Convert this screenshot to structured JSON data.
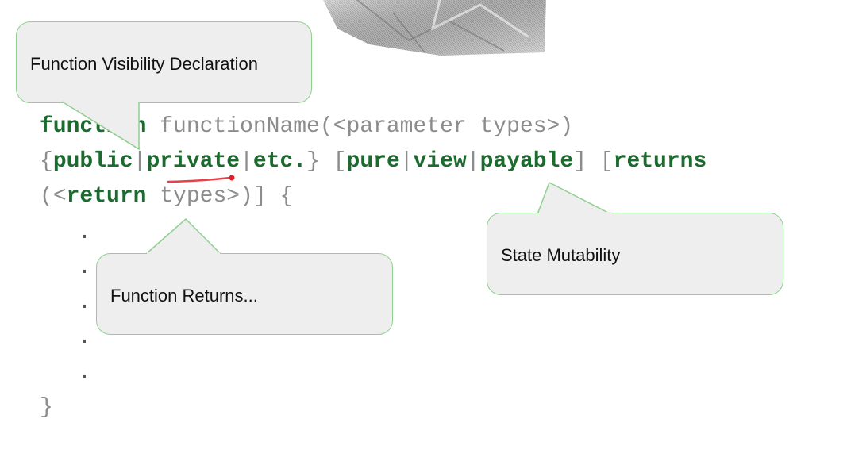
{
  "code": {
    "line1_kw": "function",
    "line1_rest": " functionName(<parameter types>)",
    "line2": {
      "brace_open": "{",
      "public": "public",
      "sep1": "|",
      "private": "private",
      "sep2": "|",
      "etc": "etc.",
      "brace_close": "} [",
      "pure": "pure",
      "sep3": "|",
      "view": "view",
      "sep4": "|",
      "payable": "payable",
      "bracket_close": "] [",
      "returns": "returns"
    },
    "line3": {
      "open": "(<",
      "return": "return",
      "rest": " types>)] {"
    },
    "dots": [
      ".",
      ".",
      ".",
      ".",
      "."
    ],
    "closing_brace": "}"
  },
  "callouts": {
    "visibility": "Function Visibility Declaration",
    "returns": "Function Returns...",
    "mutability": "State Mutability"
  },
  "colors": {
    "keyword": "#1b6b2e",
    "code_text": "#8c8c8c",
    "callout_fill": "#eeeeee",
    "callout_border": "#8fcf8f",
    "laser": "#e0202a"
  },
  "icons": {
    "laser_pointer": "laser-stroke-icon",
    "photo": "crumpled-paper-image"
  }
}
